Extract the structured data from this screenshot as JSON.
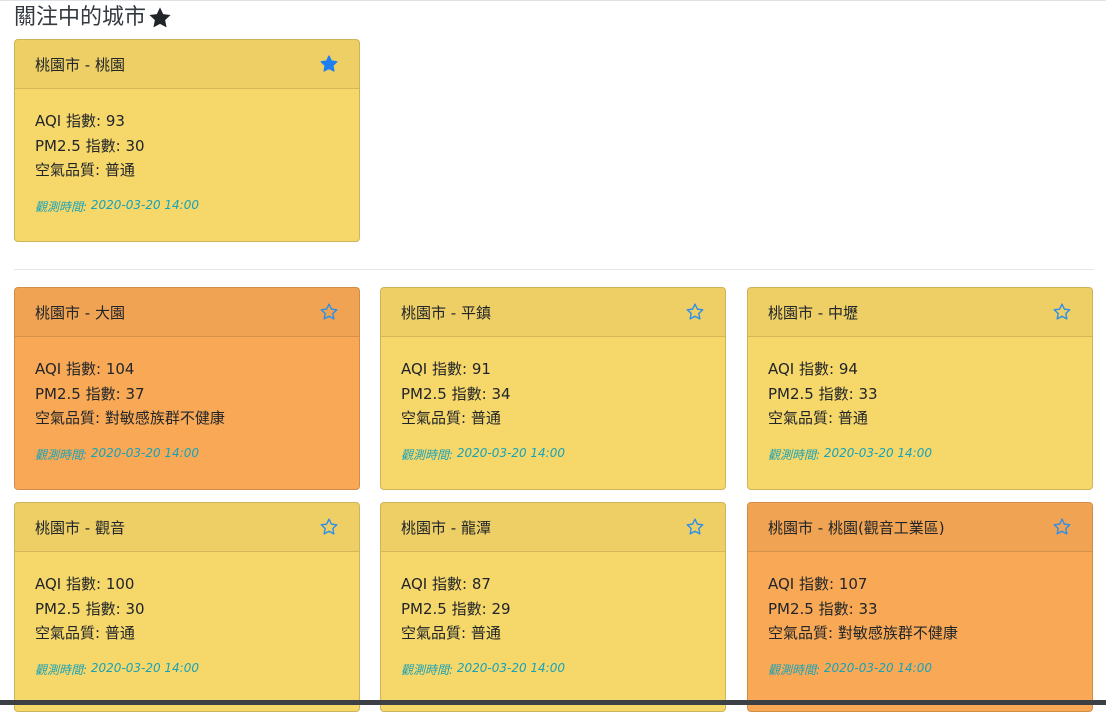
{
  "favorites": {
    "title": "關注中的城市",
    "title_icon": "star-icon",
    "cards": [
      {
        "name": "桃園市 - 桃園",
        "aqi_label": "AQI 指數: ",
        "aqi": "93",
        "pm_label": "PM2.5 指數: ",
        "pm25": "30",
        "status_label": "空氣品質: ",
        "status": "普通",
        "time_label": "觀測時間: ",
        "time": "2020-03-20 14:00",
        "starred": true,
        "color": "#f6d76a"
      }
    ]
  },
  "cities": [
    {
      "name": "桃園市 - 大園",
      "aqi_label": "AQI 指數: ",
      "aqi": "104",
      "pm_label": "PM2.5 指數: ",
      "pm25": "37",
      "status_label": "空氣品質: ",
      "status": "對敏感族群不健康",
      "time_label": "觀測時間: ",
      "time": "2020-03-20 14:00",
      "starred": false,
      "color": "#f9a955"
    },
    {
      "name": "桃園市 - 平鎮",
      "aqi_label": "AQI 指數: ",
      "aqi": "91",
      "pm_label": "PM2.5 指數: ",
      "pm25": "34",
      "status_label": "空氣品質: ",
      "status": "普通",
      "time_label": "觀測時間: ",
      "time": "2020-03-20 14:00",
      "starred": false,
      "color": "#f6d76a"
    },
    {
      "name": "桃園市 - 中壢",
      "aqi_label": "AQI 指數: ",
      "aqi": "94",
      "pm_label": "PM2.5 指數: ",
      "pm25": "33",
      "status_label": "空氣品質: ",
      "status": "普通",
      "time_label": "觀測時間: ",
      "time": "2020-03-20 14:00",
      "starred": false,
      "color": "#f6d76a"
    },
    {
      "name": "桃園市 - 觀音",
      "aqi_label": "AQI 指數: ",
      "aqi": "100",
      "pm_label": "PM2.5 指數: ",
      "pm25": "30",
      "status_label": "空氣品質: ",
      "status": "普通",
      "time_label": "觀測時間: ",
      "time": "2020-03-20 14:00",
      "starred": false,
      "color": "#f6d76a"
    },
    {
      "name": "桃園市 - 龍潭",
      "aqi_label": "AQI 指數: ",
      "aqi": "87",
      "pm_label": "PM2.5 指數: ",
      "pm25": "29",
      "status_label": "空氣品質: ",
      "status": "普通",
      "time_label": "觀測時間: ",
      "time": "2020-03-20 14:00",
      "starred": false,
      "color": "#f6d76a"
    },
    {
      "name": "桃園市 - 桃園(觀音工業區)",
      "aqi_label": "AQI 指數: ",
      "aqi": "107",
      "pm_label": "PM2.5 指數: ",
      "pm25": "33",
      "status_label": "空氣品質: ",
      "status": "對敏感族群不健康",
      "time_label": "觀測時間: ",
      "time": "2020-03-20 14:00",
      "starred": false,
      "color": "#f9a955"
    }
  ],
  "colors": {
    "star_active": "#1e7ff0",
    "star_outline": "#2f8fe8",
    "observed_text": "#17a2b8",
    "good_moderate": "#f6d76a",
    "unhealthy_sensitive": "#f9a955"
  }
}
